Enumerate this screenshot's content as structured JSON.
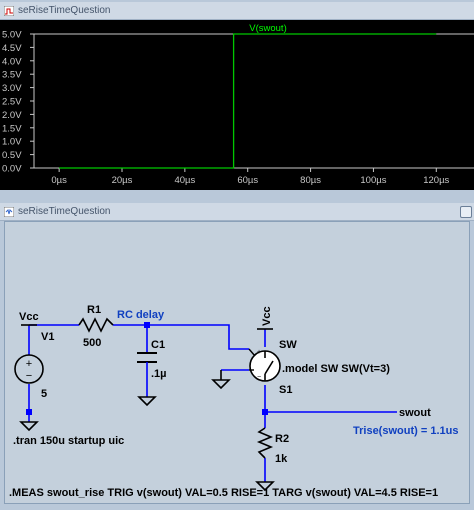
{
  "plot_window": {
    "title": "seRiseTimeQuestion",
    "trace_label": "V(swout)",
    "colors": {
      "background": "#000000",
      "trace": "#00c800",
      "axis_text": "#c8c8c8",
      "label": "#00ff00"
    }
  },
  "chart_data": {
    "type": "line",
    "title": "",
    "series": [
      {
        "name": "V(swout)",
        "x_us": [
          0,
          55.5,
          55.5,
          120
        ],
        "y_v": [
          0,
          0,
          5.0,
          5.0
        ]
      }
    ],
    "x_ticks": [
      "0µs",
      "20µs",
      "40µs",
      "60µs",
      "80µs",
      "100µs",
      "120µs"
    ],
    "x_tick_values": [
      0,
      20,
      40,
      60,
      80,
      100,
      120
    ],
    "y_ticks": [
      "0.0V",
      "0.5V",
      "1.0V",
      "1.5V",
      "2.0V",
      "2.5V",
      "3.0V",
      "3.5V",
      "4.0V",
      "4.5V",
      "5.0V"
    ],
    "y_tick_values": [
      0,
      0.5,
      1,
      1.5,
      2,
      2.5,
      3,
      3.5,
      4,
      4.5,
      5
    ],
    "xlim": [
      -8,
      132
    ],
    "ylim": [
      0,
      5
    ],
    "grid": false
  },
  "schematic_window": {
    "title": "seRiseTimeQuestion",
    "labels": {
      "vcc_left": "Vcc",
      "v1_name": "V1",
      "v1_value": "5",
      "r1_name": "R1",
      "r1_value": "500",
      "rc_delay": "RC delay",
      "c1_name": "C1",
      "c1_value": ".1µ",
      "vcc_sw": "Vcc",
      "sw_name": "SW",
      "sw_model": ".model SW SW(Vt=3)",
      "s1_name": "S1",
      "swout": "swout",
      "trise": "Trise(swout) = 1.1us",
      "r2_name": "R2",
      "r2_value": "1k",
      "tran": ".tran 150u startup uic",
      "meas": ".MEAS swout_rise TRIG v(swout) VAL=0.5 RISE=1 TARG v(swout) VAL=4.5 RISE=1"
    },
    "colors": {
      "wire": "#0000ff",
      "component": "#000000",
      "net_label": "#1040c0",
      "junction": "#0000ff"
    }
  }
}
